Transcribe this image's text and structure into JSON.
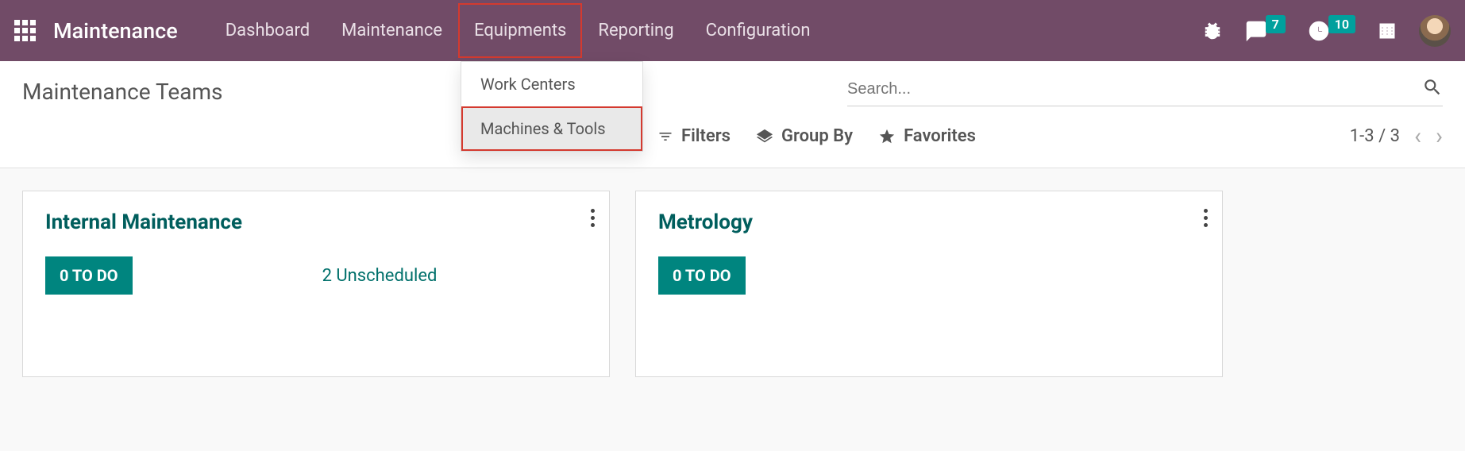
{
  "topbar": {
    "app_title": "Maintenance",
    "nav": {
      "dashboard": "Dashboard",
      "maintenance": "Maintenance",
      "equipments": "Equipments",
      "reporting": "Reporting",
      "configuration": "Configuration"
    },
    "dropdown": {
      "work_centers": "Work Centers",
      "machines_tools": "Machines & Tools"
    },
    "badges": {
      "messages": "7",
      "activities": "10"
    }
  },
  "page": {
    "title": "Maintenance Teams",
    "search_placeholder": "Search...",
    "filters_label": "Filters",
    "groupby_label": "Group By",
    "favorites_label": "Favorites",
    "pager_text": "1-3 / 3"
  },
  "cards": [
    {
      "title": "Internal Maintenance",
      "todo_label": "0 TO DO",
      "unscheduled_label": "2 Unscheduled"
    },
    {
      "title": "Metrology",
      "todo_label": "0 TO DO",
      "unscheduled_label": ""
    }
  ]
}
